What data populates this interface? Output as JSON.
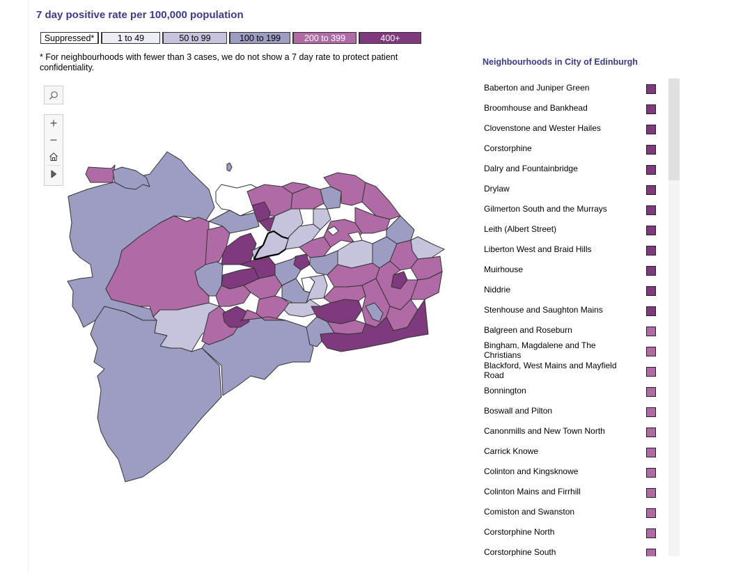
{
  "title": "7 day positive rate per 100,000 population",
  "legend": [
    {
      "label": "Suppressed*",
      "color": "#ffffff"
    },
    {
      "label": "1 to 49",
      "color": "#ededf5"
    },
    {
      "label": "50 to 99",
      "color": "#c5c4dc"
    },
    {
      "label": "100 to 199",
      "color": "#9d9cc2"
    },
    {
      "label": "200 to 399",
      "color": "#b06ba7"
    },
    {
      "label": "400+",
      "color": "#7e3a7c"
    }
  ],
  "note": "* For neighbourhoods with fewer than 3 cases, we do not show a 7 day rate to protect patient confidentiality.",
  "map_controls": {
    "search_icon": "search-icon",
    "zoom_in": "+",
    "zoom_out": "−",
    "home_icon": "home-icon",
    "expand_icon": "play-icon"
  },
  "sidebar": {
    "title": "Neighbourhoods in City of Edinburgh",
    "items": [
      {
        "name": "Baberton and Juniper Green",
        "band": "400+",
        "color": "#7e3a7c"
      },
      {
        "name": "Broomhouse and Bankhead",
        "band": "400+",
        "color": "#7e3a7c"
      },
      {
        "name": "Clovenstone and Wester Hailes",
        "band": "400+",
        "color": "#7e3a7c"
      },
      {
        "name": "Corstorphine",
        "band": "400+",
        "color": "#7e3a7c"
      },
      {
        "name": "Dalry and Fountainbridge",
        "band": "400+",
        "color": "#7e3a7c"
      },
      {
        "name": "Drylaw",
        "band": "400+",
        "color": "#7e3a7c"
      },
      {
        "name": "Gilmerton South and the Murrays",
        "band": "400+",
        "color": "#7e3a7c"
      },
      {
        "name": "Leith (Albert Street)",
        "band": "400+",
        "color": "#7e3a7c"
      },
      {
        "name": "Liberton West and Braid Hills",
        "band": "400+",
        "color": "#7e3a7c"
      },
      {
        "name": "Muirhouse",
        "band": "400+",
        "color": "#7e3a7c"
      },
      {
        "name": "Niddrie",
        "band": "400+",
        "color": "#7e3a7c"
      },
      {
        "name": "Stenhouse and Saughton Mains",
        "band": "400+",
        "color": "#7e3a7c"
      },
      {
        "name": "Balgreen and Roseburn",
        "band": "200 to 399",
        "color": "#b06ba7"
      },
      {
        "name": "Bingham, Magdalene and The Christians",
        "band": "200 to 399",
        "color": "#b06ba7"
      },
      {
        "name": "Blackford, West Mains and Mayfield Road",
        "band": "200 to 399",
        "color": "#b06ba7"
      },
      {
        "name": "Bonnington",
        "band": "200 to 399",
        "color": "#b06ba7"
      },
      {
        "name": "Boswall and Pilton",
        "band": "200 to 399",
        "color": "#b06ba7"
      },
      {
        "name": "Canonmills and New Town North",
        "band": "200 to 399",
        "color": "#b06ba7"
      },
      {
        "name": "Carrick Knowe",
        "band": "200 to 399",
        "color": "#b06ba7"
      },
      {
        "name": "Colinton and Kingsknowe",
        "band": "200 to 399",
        "color": "#b06ba7"
      },
      {
        "name": "Colinton Mains and Firrhill",
        "band": "200 to 399",
        "color": "#b06ba7"
      },
      {
        "name": "Comiston and Swanston",
        "band": "200 to 399",
        "color": "#b06ba7"
      },
      {
        "name": "Corstorphine North",
        "band": "200 to 399",
        "color": "#b06ba7"
      },
      {
        "name": "Corstorphine South",
        "band": "200 to 399",
        "color": "#b06ba7"
      }
    ]
  },
  "map": {
    "regions": [
      {
        "id": "west-rural",
        "band": "100 to 199"
      },
      {
        "id": "north-west-kirkliston",
        "band": "200 to 399"
      },
      {
        "id": "ratho-central-west",
        "band": "200 to 399"
      },
      {
        "id": "south-west-pentlands",
        "band": "100 to 199"
      },
      {
        "id": "south-pentlands-east",
        "band": "100 to 199"
      },
      {
        "id": "currie-balerno",
        "band": "50 to 99"
      },
      {
        "id": "cramond-suppressed",
        "band": "Suppressed*"
      },
      {
        "id": "south-east-gilmerton",
        "band": "400+"
      },
      {
        "id": "selected-outline",
        "band": "50 to 99"
      }
    ]
  }
}
